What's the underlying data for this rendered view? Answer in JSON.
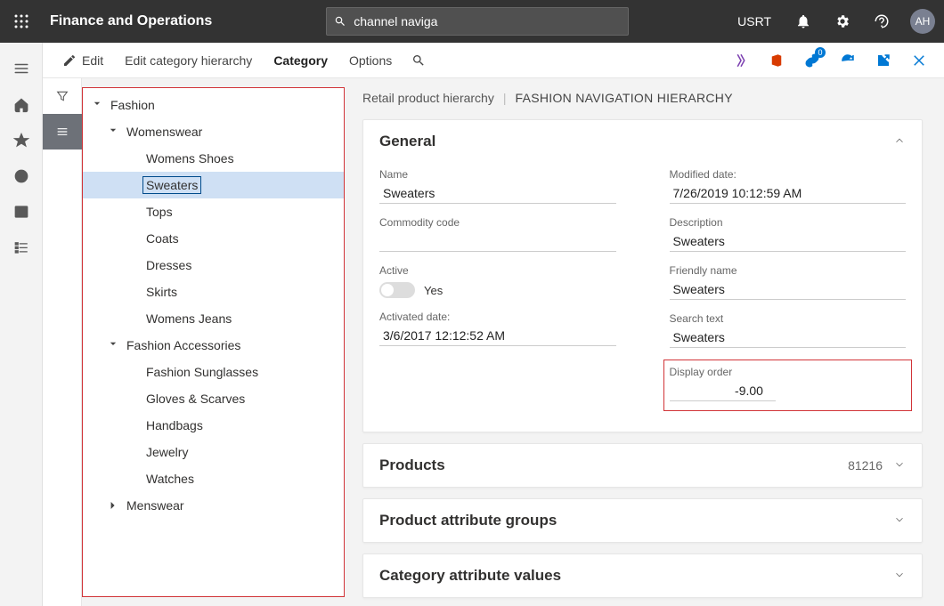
{
  "topbar": {
    "app_title": "Finance and Operations",
    "search_value": "channel naviga",
    "company": "USRT",
    "avatar_initials": "AH"
  },
  "commandbar": {
    "edit": "Edit",
    "edit_hierarchy": "Edit category hierarchy",
    "category": "Category",
    "options": "Options",
    "link_badge": "0"
  },
  "tree": {
    "n0": "Fashion",
    "n1": "Womenswear",
    "n1_0": "Womens Shoes",
    "n1_1": "Sweaters",
    "n1_2": "Tops",
    "n1_3": "Coats",
    "n1_4": "Dresses",
    "n1_5": "Skirts",
    "n1_6": "Womens Jeans",
    "n2": "Fashion Accessories",
    "n2_0": "Fashion Sunglasses",
    "n2_1": "Gloves & Scarves",
    "n2_2": "Handbags",
    "n2_3": "Jewelry",
    "n2_4": "Watches",
    "n3": "Menswear"
  },
  "breadcrumb": {
    "parent": "Retail product hierarchy",
    "current": "FASHION NAVIGATION HIERARCHY"
  },
  "panels": {
    "general": {
      "title": "General",
      "name_label": "Name",
      "name_value": "Sweaters",
      "commodity_label": "Commodity code",
      "commodity_value": "",
      "active_label": "Active",
      "active_text": "Yes",
      "activated_label": "Activated date:",
      "activated_value": "3/6/2017 12:12:52 AM",
      "modified_label": "Modified date:",
      "modified_value": "7/26/2019 10:12:59 AM",
      "description_label": "Description",
      "description_value": "Sweaters",
      "friendly_label": "Friendly name",
      "friendly_value": "Sweaters",
      "search_label": "Search text",
      "search_value": "Sweaters",
      "display_order_label": "Display order",
      "display_order_value": "-9.00"
    },
    "products": {
      "title": "Products",
      "count": "81216"
    },
    "attr_groups": {
      "title": "Product attribute groups"
    },
    "cat_attr": {
      "title": "Category attribute values"
    }
  }
}
